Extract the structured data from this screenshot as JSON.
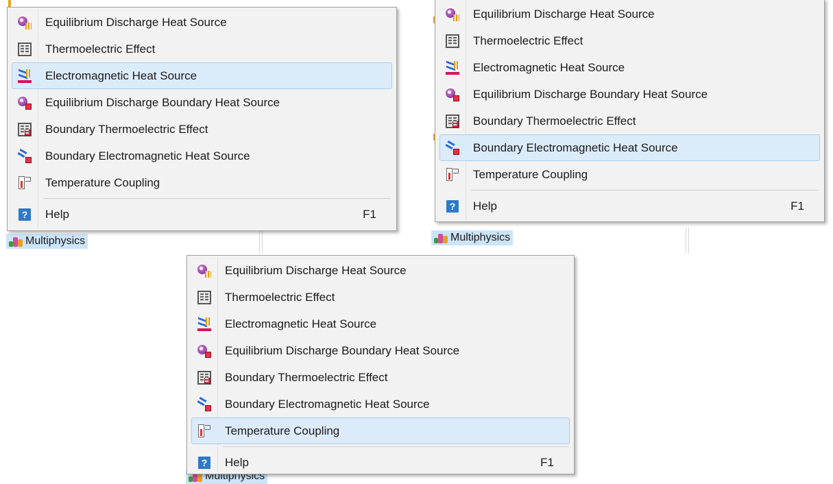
{
  "menu_items": [
    {
      "label": "Equilibrium Discharge Heat Source",
      "icon": "equilibrium-discharge-icon"
    },
    {
      "label": "Thermoelectric Effect",
      "icon": "thermoelectric-icon"
    },
    {
      "label": "Electromagnetic Heat Source",
      "icon": "electromagnetic-heat-icon"
    },
    {
      "label": "Equilibrium Discharge Boundary Heat Source",
      "icon": "equilibrium-boundary-icon"
    },
    {
      "label": "Boundary Thermoelectric Effect",
      "icon": "boundary-thermoelectric-icon"
    },
    {
      "label": "Boundary Electromagnetic Heat Source",
      "icon": "boundary-electromagnetic-icon"
    },
    {
      "label": "Temperature Coupling",
      "icon": "temperature-coupling-icon"
    }
  ],
  "help": {
    "label": "Help",
    "shortcut": "F1",
    "icon": "help-icon"
  },
  "node_label": "Multiphysics",
  "panels": [
    {
      "highlighted_index": 2
    },
    {
      "highlighted_index": 5
    },
    {
      "highlighted_index": 6
    }
  ],
  "colors": {
    "highlight_bg": "#dcebfa",
    "highlight_border": "#a7cdea",
    "menu_bg": "#f2f2f2",
    "selected_node_bg": "#cce4f7"
  }
}
